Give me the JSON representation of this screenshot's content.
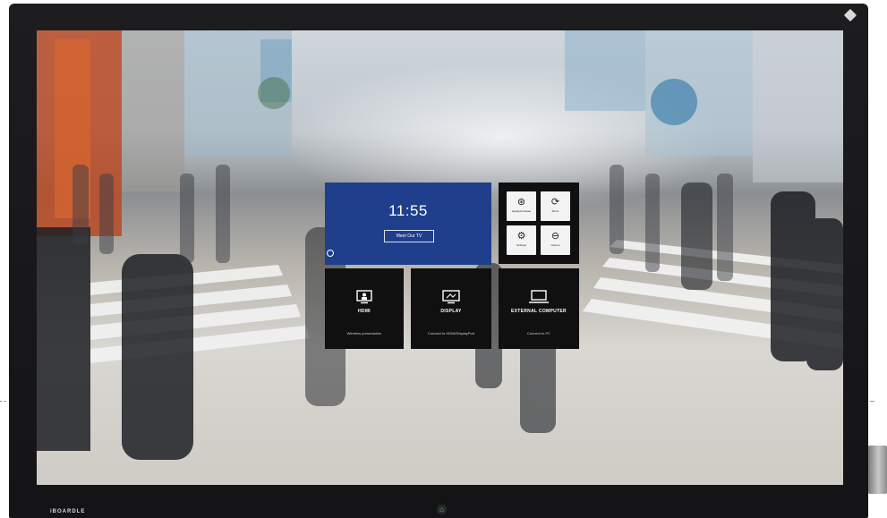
{
  "clock": {
    "time": "11:55",
    "button_label": "Meet Our TV"
  },
  "quick_actions": [
    {
      "icon": "link-icon",
      "glyph": "⊛",
      "label": "airplay/miracast"
    },
    {
      "icon": "power-icon",
      "glyph": "⟳",
      "label": "Mirror"
    },
    {
      "icon": "settings-icon",
      "glyph": "⚙",
      "label": "Settings"
    },
    {
      "icon": "minus-circle-icon",
      "glyph": "⊖",
      "label": "Volume"
    }
  ],
  "apps": [
    {
      "title": "HDMI",
      "subtitle": "Wireless presentation"
    },
    {
      "title": "DISPLAY",
      "subtitle": "Connect to HDMI/DisplayPort"
    },
    {
      "title": "EXTERNAL COMPUTER",
      "subtitle": "Connect to PC"
    }
  ],
  "bezel": {
    "brand": "iBOARDLE"
  },
  "colors": {
    "accent": "#1f3f8c",
    "tile": "#101010",
    "home": "#3fd08a"
  }
}
